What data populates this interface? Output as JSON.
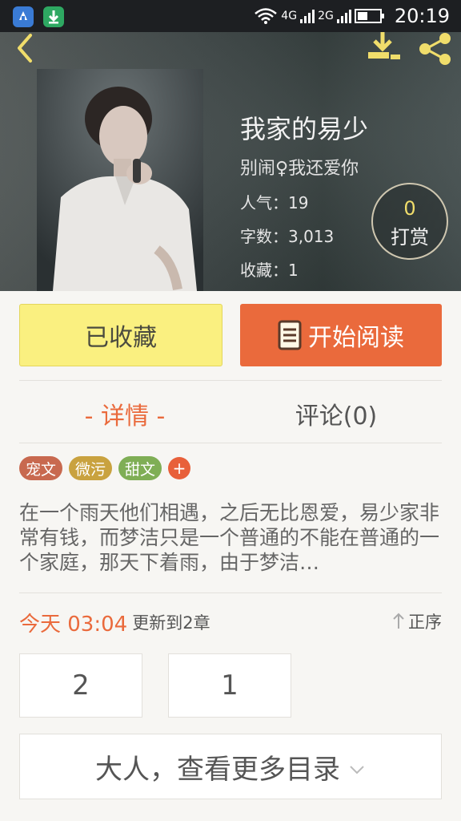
{
  "status_bar": {
    "network_primary": "4G",
    "network_secondary": "2G",
    "time": "20:19"
  },
  "header": {
    "icons": {
      "back": "back-arrow-icon",
      "download": "download-icon",
      "share": "share-icon"
    },
    "accent_color": "#f0dd6b"
  },
  "book": {
    "title": "我家的易少",
    "author": "别闹♀我还爱你",
    "stats": {
      "popularity": "人气：19",
      "word_count": "字数：3,013",
      "favorites": "收藏：1"
    }
  },
  "reward": {
    "count": "0",
    "label": "打赏"
  },
  "actions": {
    "collected_label": "已收藏",
    "read_label": "开始阅读",
    "read_color": "#ea6a3c",
    "collected_color": "#faf080"
  },
  "tabs": {
    "detail": "- 详情 -",
    "comments": "评论(0)"
  },
  "tags": [
    {
      "label": "宠文",
      "color": "#c8694f"
    },
    {
      "label": "微污",
      "color": "#c9a23f"
    },
    {
      "label": "甜文",
      "color": "#7fae55"
    }
  ],
  "tags_add": "+",
  "description": "在一个雨天他们相遇，之后无比恩爱，易少家非常有钱，而梦洁只是一个普通的不能在普通的一个家庭，那天下着雨，由于梦洁…",
  "update": {
    "time": "今天 03:04",
    "text": "更新到2章",
    "sort_label": "正序"
  },
  "chapters": [
    "2",
    "1"
  ],
  "more_catalog": "大人，查看更多目录"
}
